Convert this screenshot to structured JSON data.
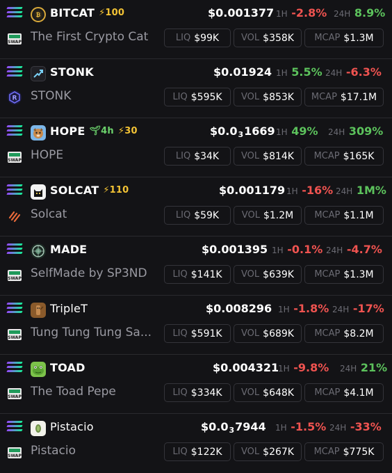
{
  "labels": {
    "h1": "1H",
    "h24": "24H",
    "liq": "LIQ",
    "vol": "VOL",
    "mcap": "MCAP"
  },
  "colors": {
    "negative": "#ef5350",
    "positive": "#5cc25c",
    "boost": "#f3c335",
    "age": "#6cd26c"
  },
  "tokens": [
    {
      "symbol": "BITCAT",
      "boost": "⚡100",
      "age": "",
      "name": "The First Crypto Cat",
      "price": "$0.001377",
      "price_prefix": "",
      "price_zeros": "",
      "price_tail": "",
      "h1": "-2.8%",
      "h24": "8.9%",
      "liq": "$99K",
      "vol": "$358K",
      "mcap": "$1.3M",
      "dex_icon": "swap-icon",
      "logo_icon": "cat-coin-icon"
    },
    {
      "symbol": "STONK",
      "boost": "",
      "age": "",
      "name": "STONK",
      "price": "$0.01924",
      "price_prefix": "",
      "price_zeros": "",
      "price_tail": "",
      "h1": "5.5%",
      "h24": "-6.3%",
      "liq": "$595K",
      "vol": "$853K",
      "mcap": "$17.1M",
      "dex_icon": "raydium-icon",
      "logo_icon": "stonk-arrow-icon"
    },
    {
      "symbol": "HOPE",
      "boost": "⚡30",
      "age": "4h",
      "name": "HOPE",
      "price": "",
      "price_prefix": "$0.0",
      "price_zeros": "3",
      "price_tail": "1669",
      "h1": "49%",
      "h24": "309%",
      "liq": "$34K",
      "vol": "$814K",
      "mcap": "$165K",
      "dex_icon": "swap-icon",
      "logo_icon": "dog-icon"
    },
    {
      "symbol": "SOLCAT",
      "boost": "⚡110",
      "age": "",
      "name": "Solcat",
      "price": "$0.001179",
      "price_prefix": "",
      "price_zeros": "",
      "price_tail": "",
      "h1": "-16%",
      "h24": "1M%",
      "liq": "$59K",
      "vol": "$1.2M",
      "mcap": "$1.1M",
      "dex_icon": "pumpfun-icon",
      "logo_icon": "black-cat-icon"
    },
    {
      "symbol": "MADE",
      "boost": "",
      "age": "",
      "name": "SelfMade by SP3ND",
      "price": "$0.001395",
      "price_prefix": "",
      "price_zeros": "",
      "price_tail": "",
      "h1": "-0.1%",
      "h24": "-4.7%",
      "liq": "$141K",
      "vol": "$639K",
      "mcap": "$1.3M",
      "dex_icon": "swap-icon",
      "logo_icon": "made-emblem-icon"
    },
    {
      "symbol": "TripleT",
      "boost": "",
      "age": "",
      "name": "Tung Tung Tung Sa...",
      "price": "$0.008296",
      "price_prefix": "",
      "price_zeros": "",
      "price_tail": "",
      "h1": "-1.8%",
      "h24": "-17%",
      "liq": "$591K",
      "vol": "$689K",
      "mcap": "$8.2M",
      "dex_icon": "swap-icon",
      "logo_icon": "wood-figure-icon"
    },
    {
      "symbol": "TOAD",
      "boost": "",
      "age": "",
      "name": "The Toad Pepe",
      "price": "$0.004321",
      "price_prefix": "",
      "price_zeros": "",
      "price_tail": "",
      "h1": "-9.8%",
      "h24": "21%",
      "liq": "$334K",
      "vol": "$648K",
      "mcap": "$4.1M",
      "dex_icon": "swap-icon",
      "logo_icon": "toad-icon"
    },
    {
      "symbol": "Pistacio",
      "boost": "",
      "age": "",
      "name": "Pistacio",
      "price": "",
      "price_prefix": "$0.0",
      "price_zeros": "3",
      "price_tail": "7944",
      "h1": "-1.5%",
      "h24": "-33%",
      "liq": "$122K",
      "vol": "$267K",
      "mcap": "$775K",
      "dex_icon": "swap-icon",
      "logo_icon": "pistachio-icon"
    }
  ]
}
